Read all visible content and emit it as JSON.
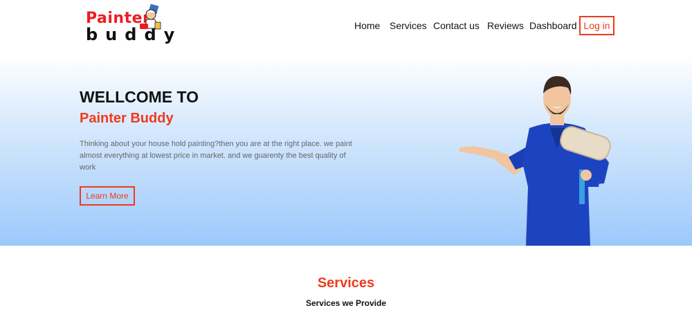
{
  "logo": {
    "line1": "Painter",
    "line2": "buddy",
    "mascot_icon": "painter-mascot-icon"
  },
  "nav": {
    "items": [
      {
        "label": "Home"
      },
      {
        "label": "Services"
      },
      {
        "label": "Contact us"
      },
      {
        "label": "Reviews"
      },
      {
        "label": "Dashboard"
      }
    ],
    "login_label": "Log in"
  },
  "hero": {
    "title": "WELLCOME TO",
    "subtitle": "Painter Buddy",
    "description": "Thinking about your house hold painting?then you are at the right place. we paint almost everything at lowest price in market. and we guarenty the best quality of work",
    "button_label": "Learn More",
    "image_icon": "painter-holding-roller-image"
  },
  "services": {
    "title": "Services",
    "subtitle": "Services we Provide"
  },
  "colors": {
    "accent": "#ee3b1c",
    "logo_red": "#ee1c24",
    "text": "#111111",
    "hero_gradient_end": "#9cc9fb"
  }
}
